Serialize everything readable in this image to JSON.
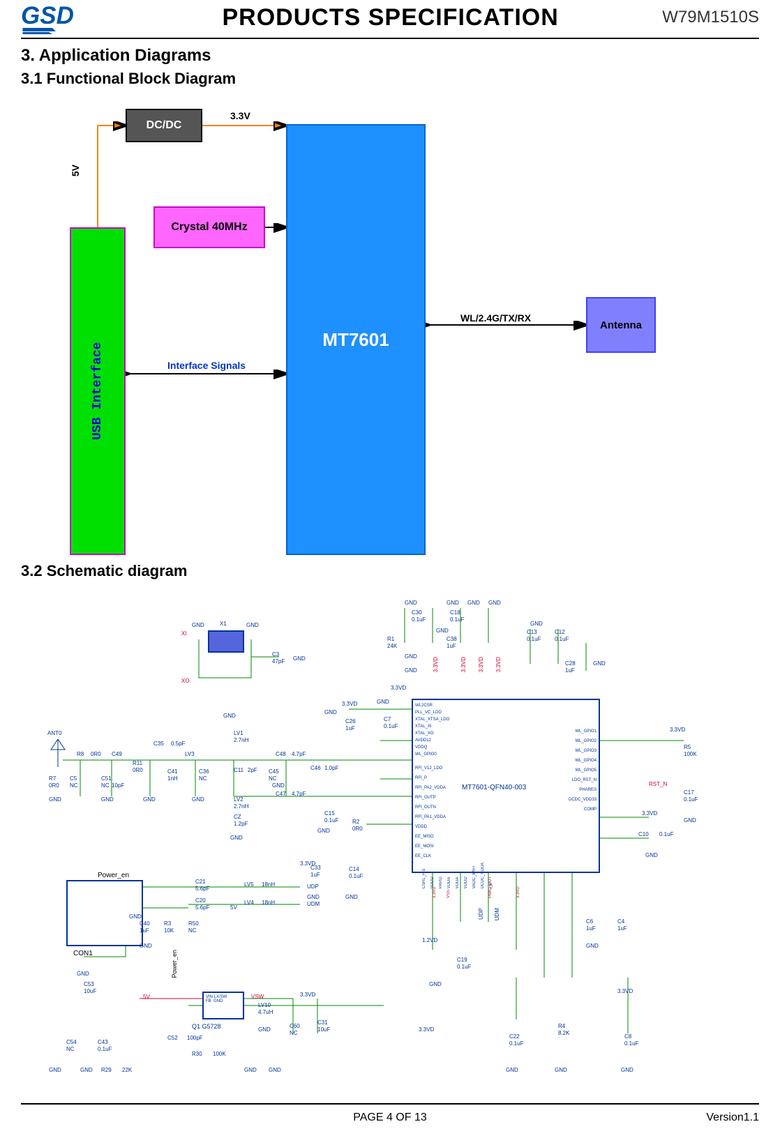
{
  "header": {
    "logo_text": "GSD",
    "title": "PRODUCTS SPECIFICATION",
    "part_number": "W79M1510S"
  },
  "sections": {
    "s3_title": "3.      Application Diagrams",
    "s31_title": "3.1      Functional Block Diagram",
    "s32_title": "3.2      Schematic diagram"
  },
  "block_diagram": {
    "usb_label": "USB Interface",
    "dcdc_label": "DC/DC",
    "crystal_label": "Crystal 40MHz",
    "chip_label": "MT7601",
    "antenna_label": "Antenna",
    "voltage_5v": "5V",
    "voltage_33v": "3.3V",
    "if_signals": "Interface Signals",
    "rf_label": "WL/2.4G/TX/RX"
  },
  "schematic": {
    "chip_name": "MT7601-QFN40-003",
    "voltage_rails": {
      "v33": "3.3VD",
      "v12": "1.2VD",
      "v5": "5V",
      "vsw": "VSW"
    },
    "antenna": "ANT0",
    "connector": "CON1",
    "power_en": "Power_en",
    "crystal": "X1",
    "xo_net": "XO",
    "xi_net": "XI",
    "reset": "RST_N",
    "diff_pairs": {
      "udp": "UDP",
      "udm": "UDM"
    },
    "regulator": "Q1  G5728",
    "regulator_pins": "VIN LX/SW\nFB  GND",
    "signals": {
      "udp2": "UDP",
      "udm2": "UDM"
    },
    "chip_pins_left": [
      "WL2CSR",
      "PLL_VC_LDO",
      "XTAL_XTSA_LDO",
      "XTAL_XI",
      "XTAL_XO",
      "AVDD12",
      "VDDQ",
      "WL_GPIO0",
      "RFI_V12_LDO",
      "RFI_P",
      "RFI_PA2_VDDA",
      "RFI_OUTP",
      "RFI_OUTN",
      "RFI_PA1_VDDA",
      "VDDD",
      "EE_MISO",
      "EE_MOSI",
      "EE_CLK"
    ],
    "chip_pins_right": [
      "WL_GPIO1",
      "WL_GPIO2",
      "WL_GPIO3",
      "WL_GPIO4",
      "WL_GPIO5",
      "LDO_RST_N",
      "PHARES",
      "DCDC_VDD33",
      "COMP"
    ],
    "chip_pins_bottom": [
      "CSRL_FIS",
      "VDDD",
      "PAVID",
      "VDDA",
      "VDDA",
      "VDDD",
      "VADC_WIFI",
      "DCDC_VDDA",
      "FB"
    ],
    "chip_pins_bottom_below": [
      "",
      "3.3VD",
      "VSS",
      "",
      "",
      "PMIC_OUT",
      "",
      "3.3VD"
    ],
    "gnd_label": "GND",
    "nc_label": "NC",
    "components": {
      "R1": {
        "ref": "R1",
        "val": "24K"
      },
      "R2": {
        "ref": "R2",
        "val": "0R0"
      },
      "R3": {
        "ref": "R3",
        "val": "10K"
      },
      "R4": {
        "ref": "R4",
        "val": "8.2K"
      },
      "R5": {
        "ref": "R5",
        "val": "100K"
      },
      "R7": {
        "ref": "R7",
        "val": "0R0"
      },
      "R8": {
        "ref": "R8",
        "val": "0R0"
      },
      "R11": {
        "ref": "R11",
        "val": "0R0"
      },
      "R29": {
        "ref": "R29",
        "val": "22K"
      },
      "R30": {
        "ref": "R30",
        "val": "100K"
      },
      "R50": {
        "ref": "R50",
        "val": "NC"
      },
      "C3": {
        "ref": "C3",
        "val": "47pF"
      },
      "C4": {
        "ref": "C4",
        "val": "1uF"
      },
      "C5": {
        "ref": "C5",
        "val": "NC"
      },
      "C6": {
        "ref": "C6",
        "val": "1uF"
      },
      "C7": {
        "ref": "C7",
        "val": "0.1uF"
      },
      "C8": {
        "ref": "C8",
        "val": "0.1uF"
      },
      "C10": {
        "ref": "C10",
        "val": "0.1uF"
      },
      "C11": {
        "ref": "C11",
        "val": "2pF"
      },
      "C12": {
        "ref": "C12",
        "val": "0.1uF"
      },
      "C13": {
        "ref": "C13",
        "val": "0.1uF"
      },
      "C14": {
        "ref": "C14",
        "val": "0.1uF"
      },
      "C15": {
        "ref": "C15",
        "val": "0.1uF"
      },
      "C17": {
        "ref": "C17",
        "val": "0.1uF"
      },
      "C18": {
        "ref": "C18",
        "val": "0.1uF"
      },
      "C19": {
        "ref": "C19",
        "val": "0.1uF"
      },
      "C20": {
        "ref": "C20",
        "val": "5.6pF"
      },
      "C21": {
        "ref": "C21",
        "val": "5.6pF"
      },
      "C22": {
        "ref": "C22",
        "val": "0.1uF"
      },
      "C26": {
        "ref": "C26",
        "val": "1uF"
      },
      "C28": {
        "ref": "C28",
        "val": "1uF"
      },
      "C30": {
        "ref": "C30",
        "val": "0.1uF"
      },
      "C31": {
        "ref": "C31",
        "val": "10uF"
      },
      "C33": {
        "ref": "C33",
        "val": "1uF"
      },
      "C35": {
        "ref": "C35",
        "val": "0.5pF"
      },
      "C36": {
        "ref": "C36",
        "val": "NC"
      },
      "C38": {
        "ref": "C38",
        "val": "1uF"
      },
      "C40": {
        "ref": "C40",
        "val": "1uF"
      },
      "C41": {
        "ref": "C41",
        "val": "1nH"
      },
      "C43": {
        "ref": "C43",
        "val": "0.1uF"
      },
      "C45": {
        "ref": "C45",
        "val": "NC"
      },
      "C46": {
        "ref": "C46",
        "val": "1.0pF"
      },
      "C47": {
        "ref": "C47",
        "val": "4.7pF"
      },
      "C48": {
        "ref": "C48",
        "val": "4.7pF"
      },
      "C49": {
        "ref": "C49",
        "val": "10pF"
      },
      "C51": {
        "ref": "C51",
        "val": "NC"
      },
      "C52": {
        "ref": "C52",
        "val": "100pF"
      },
      "C53": {
        "ref": "C53",
        "val": "10uF"
      },
      "C54": {
        "ref": "C54",
        "val": "NC"
      },
      "C60": {
        "ref": "C60",
        "val": "NC"
      },
      "LV1": {
        "ref": "LV1",
        "val": "2.7nH"
      },
      "LV2": {
        "ref": "LV2",
        "val": "2.7nH"
      },
      "LV3": {
        "ref": "LV3",
        "val": ""
      },
      "LV4": {
        "ref": "LV4",
        "val": "18nH"
      },
      "LV5": {
        "ref": "LV5",
        "val": "18nH"
      },
      "LV10": {
        "ref": "LV10",
        "val": "4.7uH"
      },
      "CZ": {
        "ref": "CZ",
        "val": "1.2pF"
      }
    }
  },
  "footer": {
    "page_label": "PAGE    4    OF    13",
    "version": "Version1.1"
  }
}
